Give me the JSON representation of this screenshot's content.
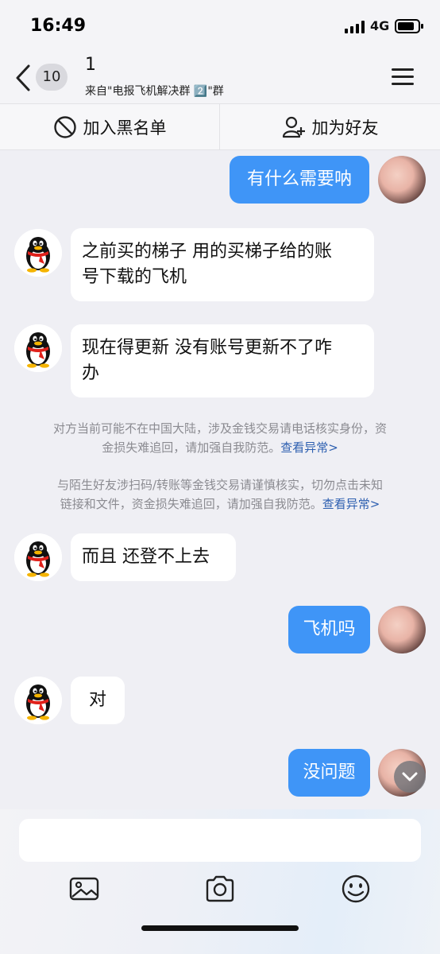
{
  "status_bar": {
    "time": "16:49",
    "network": "4G"
  },
  "header": {
    "back_count": "10",
    "title": "1",
    "subtitle": "来自\"电报飞机解决群 2️⃣\"群",
    "menu_icon": "hamburger-menu-icon"
  },
  "actions": {
    "blacklist_label": "加入黑名单",
    "add_friend_label": "加为好友"
  },
  "messages": [
    {
      "side": "out",
      "text": "有什么需要呐"
    },
    {
      "side": "in",
      "line1": "之前买的梯子 用的买梯子给的账",
      "line2": "号下载的飞机"
    },
    {
      "side": "in",
      "line1": "现在得更新 没有账号更新不了咋",
      "line2": "办"
    },
    {
      "side": "in",
      "text": "而且 还登不上去"
    },
    {
      "side": "out",
      "text": "飞机吗"
    },
    {
      "side": "in",
      "text": "对"
    },
    {
      "side": "out",
      "text": "没问题"
    }
  ],
  "notices": [
    {
      "line1": "对方当前可能不在中国大陆，涉及金钱交易请电话核实身份，资",
      "line2": "金损失难追回，请加强自我防范。",
      "link": "查看异常>"
    },
    {
      "line1": "与陌生好友涉扫码/转账等金钱交易请谨慎核实，切勿点击未知",
      "line2": "链接和文件，资金损失难追回，请加强自我防范。",
      "link": "查看异常>"
    }
  ],
  "colors": {
    "outgoing_bubble": "#3f95f7",
    "incoming_bubble": "#ffffff",
    "link": "#2d5fb0",
    "background": "#efeff4"
  },
  "toolbar": {
    "icons": [
      "image-icon",
      "camera-icon",
      "emoji-icon"
    ]
  }
}
